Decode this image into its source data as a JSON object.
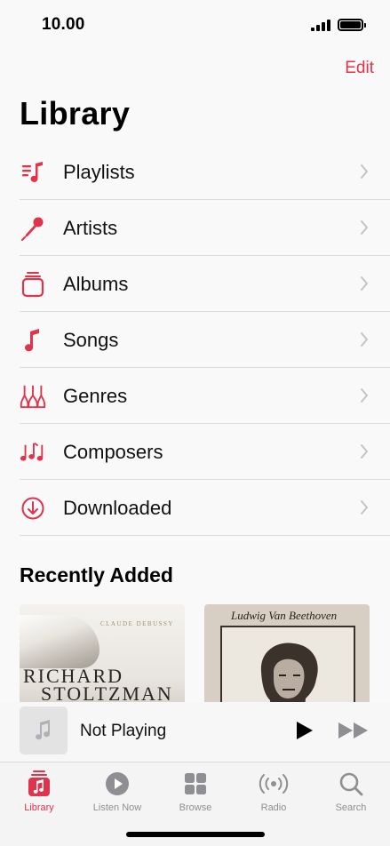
{
  "status": {
    "time": "10.00"
  },
  "header": {
    "edit_label": "Edit",
    "title": "Library"
  },
  "library_items": [
    {
      "label": "Playlists",
      "icon": "playlists-icon"
    },
    {
      "label": "Artists",
      "icon": "microphone-icon"
    },
    {
      "label": "Albums",
      "icon": "albums-icon"
    },
    {
      "label": "Songs",
      "icon": "music-note-icon"
    },
    {
      "label": "Genres",
      "icon": "guitars-icon"
    },
    {
      "label": "Composers",
      "icon": "composers-icon"
    },
    {
      "label": "Downloaded",
      "icon": "download-icon"
    }
  ],
  "recently_added": {
    "title": "Recently Added",
    "albums": [
      {
        "composer": "CLAUDE DEBUSSY",
        "line1": "RICHARD",
        "line2": "STOLTZMAN"
      },
      {
        "title": "Ludwig Van Beethoven"
      }
    ]
  },
  "player": {
    "title": "Not Playing"
  },
  "tabs": [
    {
      "label": "Library",
      "icon": "library-icon",
      "active": true
    },
    {
      "label": "Listen Now",
      "icon": "listen-now-icon",
      "active": false
    },
    {
      "label": "Browse",
      "icon": "browse-icon",
      "active": false
    },
    {
      "label": "Radio",
      "icon": "radio-icon",
      "active": false
    },
    {
      "label": "Search",
      "icon": "search-icon",
      "active": false
    }
  ],
  "colors": {
    "accent": "#e0344c",
    "inactive": "#8e8e93"
  }
}
